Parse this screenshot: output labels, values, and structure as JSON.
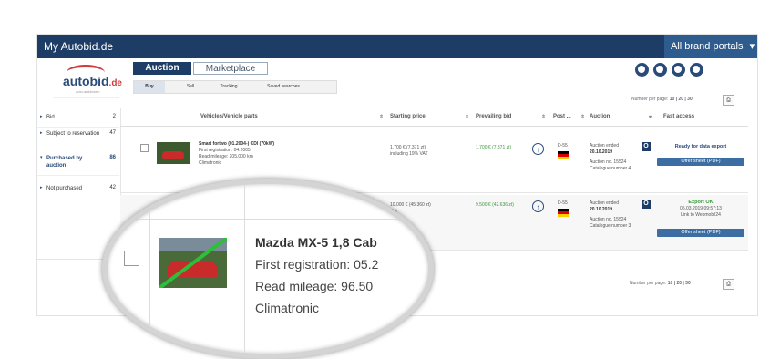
{
  "topbar": {
    "title": "My Autobid.de",
    "portals_label": "All brand portals",
    "portals_arrow": "▾"
  },
  "logo": {
    "brand": "autobid",
    "tld": ".de",
    "tagline": "auto-auktionen"
  },
  "tabs": {
    "auction": "Auction",
    "marketplace": "Marketplace"
  },
  "subtabs": [
    "Buy",
    "Sell",
    "Tracking",
    "Saved searches"
  ],
  "header_icons": [
    "filter-icon",
    "email-icon",
    "user-icon",
    "bell-icon"
  ],
  "number_per_page": {
    "label": "Number per page:",
    "options": "10 | 20 | 30",
    "print_icon": "⎙"
  },
  "sidebar": [
    {
      "label": "Bid",
      "count": "2",
      "arrow": "▸"
    },
    {
      "label": "Subject to reservation",
      "count": "47",
      "arrow": "▸"
    },
    {
      "label": "Purchased by auction",
      "count": "86",
      "arrow": "▾"
    },
    {
      "label": "Not purchased",
      "count": "42",
      "arrow": "▸"
    }
  ],
  "columns": {
    "vehicles": "Vehicles/Vehicle parts",
    "starting": "Starting price",
    "prevailing": "Prevailing bid",
    "post": "Post ...",
    "auction": "Auction",
    "fast": "Fast access",
    "sort": "⇕",
    "sort_down": "▾"
  },
  "rows": [
    {
      "title": "Smart fortwo (01.2004-) CDI (70kW)",
      "first_reg": "First registration: 04.2005",
      "mileage": "Read mileage: 205.000 km",
      "extra": "Climatronic",
      "starting_price": "1.700 € (7.371 zt)",
      "starting_note": "including 19% VAT",
      "prevailing_bid": "1.700 € (7.371 zt)",
      "post_code": "D-55",
      "auction_status": "Auction ended",
      "auction_date": "20.10.2019",
      "auction_no": "Auction no. 15524",
      "catalogue": "Catalogue number 4",
      "badge": "O",
      "fast_title": "Ready for data export",
      "fast_button": "Offer sheet (PDF)",
      "up_arrow": "↑"
    },
    {
      "starting_price": "10.000 € (45.360 zt)",
      "starting_note": "Net",
      "prevailing_bid": "9.500 € (42.636 zt)",
      "post_code": "D-55",
      "auction_status": "Auction ended",
      "auction_date": "20.10.2019",
      "auction_no": "Auction no. 15524",
      "catalogue": "Catalogue number 3",
      "badge": "O",
      "fast_title": "Export OK",
      "fast_line2": "05.03.2019 09:57:13",
      "fast_line3": "Link to Webmobil24",
      "fast_button": "Offer sheet (PDF)",
      "up_arrow": "↑"
    }
  ],
  "magnifier": {
    "title": "Mazda MX-5 1,8 Cab",
    "first_reg": "First registration: 05.2",
    "mileage": "Read mileage: 96.50",
    "extra": "Climatronic"
  }
}
